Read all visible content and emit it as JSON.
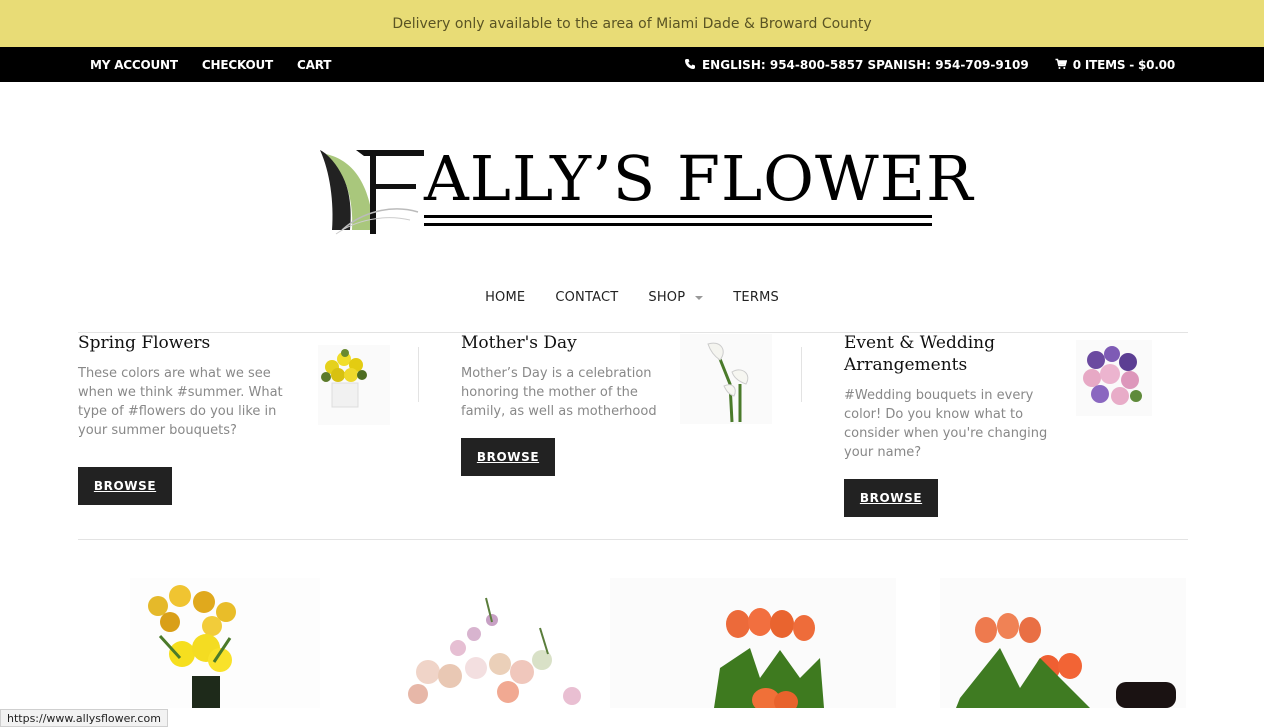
{
  "notice": "Delivery only available to the area of Miami Dade & Broward County",
  "top_bar": {
    "left_links": [
      "MY ACCOUNT",
      "CHECKOUT",
      "CART"
    ],
    "phone_icon": "phone-icon",
    "phone_text": "ENGLISH: 954-800-5857 SPANISH: 954-709-9109",
    "cart_icon": "cart-icon",
    "cart_text": "0 ITEMS - $0.00"
  },
  "logo": {
    "text": "Ally's Flower",
    "display": "ALLY’S FLOWER"
  },
  "main_nav": {
    "items": [
      "HOME",
      "CONTACT",
      "SHOP",
      "TERMS"
    ]
  },
  "categories": [
    {
      "title": "Spring Flowers",
      "description": "These colors are what we see when we think #summer. What type of #flowers do you like in your summer bouquets?",
      "button": "BROWSE"
    },
    {
      "title": "Mother's Day",
      "description": "Mother’s Day is a celebration honoring the mother of the family, as well as motherhood",
      "button": "BROWSE"
    },
    {
      "title": "Event & Wedding Arrangements",
      "description": "#Wedding bouquets in every color! Do you know what to consider when you're changing your name?",
      "button": "BROWSE"
    }
  ],
  "status_bar_url": "https://www.allysflower.com",
  "colors": {
    "notice_bg": "#e8dc76",
    "top_bar_bg": "#000000",
    "button_bg": "#222222"
  }
}
